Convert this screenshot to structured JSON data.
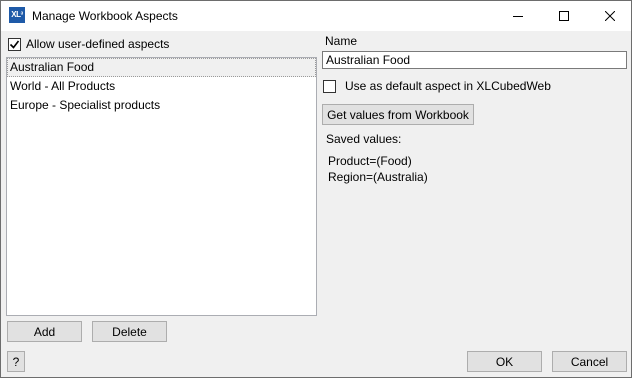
{
  "window": {
    "title": "Manage Workbook Aspects",
    "app_icon_text": "XL³"
  },
  "allow_user_defined": {
    "label": "Allow user-defined aspects",
    "checked": true
  },
  "aspects_list": {
    "items": [
      {
        "label": "Australian Food",
        "selected": true
      },
      {
        "label": "World - All Products",
        "selected": false
      },
      {
        "label": "Europe - Specialist products",
        "selected": false
      }
    ]
  },
  "left_buttons": {
    "add_label": "Add",
    "delete_label": "Delete"
  },
  "details": {
    "name_label": "Name",
    "name_value": "Australian Food",
    "default_aspect_label": "Use as default aspect in XLCubedWeb",
    "default_aspect_checked": false,
    "get_values_label": "Get values from Workbook",
    "saved_values_label": "Saved values:",
    "saved_values": [
      "Product=(Food)",
      "Region=(Australia)"
    ]
  },
  "footer": {
    "help_label": "?",
    "ok_label": "OK",
    "cancel_label": "Cancel"
  }
}
